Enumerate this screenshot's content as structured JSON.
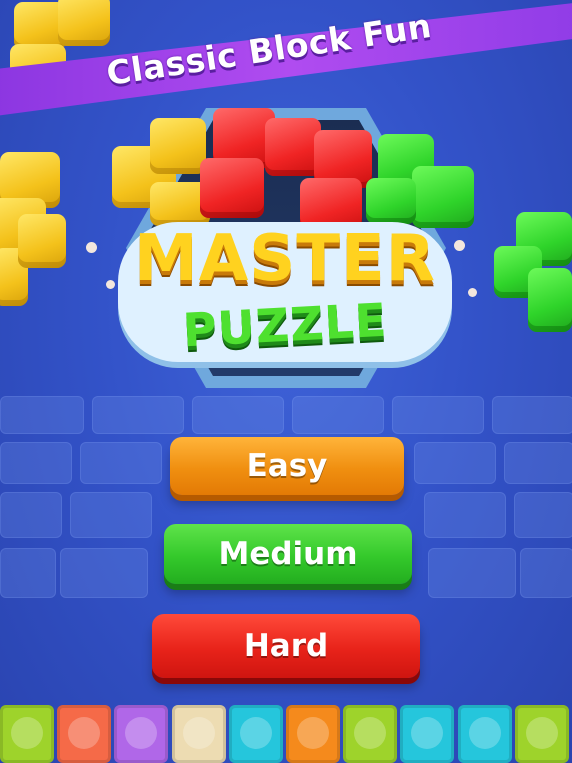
{
  "banner": {
    "text": "Classic Block Fun"
  },
  "logo": {
    "line1": "MASTER",
    "line2": "PUZZLE"
  },
  "difficulty": {
    "easy": "Easy",
    "medium": "Medium",
    "hard": "Hard"
  },
  "colors": {
    "background": "#3353c9",
    "ribbon": "#a046ec",
    "easy": "#f08f10",
    "medium": "#34c92b",
    "hard": "#e8231a"
  },
  "bottom_tiles": [
    "#9ed32b",
    "#f56a48",
    "#b067e8",
    "#eddcb2",
    "#25c6dc",
    "#f58a1c",
    "#9ed32b",
    "#25c6dc",
    "#25c6dc",
    "#9ed32b"
  ]
}
